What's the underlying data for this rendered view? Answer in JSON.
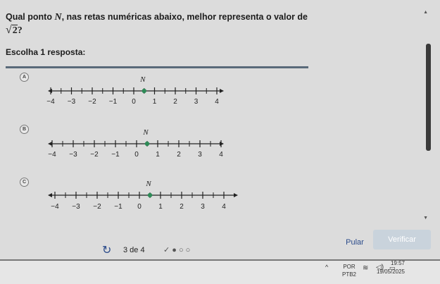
{
  "question": {
    "prefix": "Qual ponto ",
    "variable": "N",
    "suffix": ", nas retas numéricas abaixo, melhor representa o valor de",
    "radicand": "2",
    "end": "?"
  },
  "instruction": "Escolha 1 resposta:",
  "options": [
    {
      "letter": "A",
      "point_value": 0.5,
      "point_label": "N",
      "ticks": [
        "−4",
        "−3",
        "−2",
        "−1",
        "0",
        "1",
        "2",
        "3",
        "4"
      ]
    },
    {
      "letter": "B",
      "point_value": 0.5,
      "point_label": "N",
      "ticks": [
        "−4",
        "−3",
        "−2",
        "−1",
        "0",
        "1",
        "2",
        "3",
        "4"
      ]
    },
    {
      "letter": "C",
      "point_value": 0.5,
      "point_label": "N",
      "ticks": [
        "−4",
        "−3",
        "−2",
        "−1",
        "0",
        "1",
        "2",
        "3",
        "4"
      ]
    }
  ],
  "footer": {
    "counter": "3 de 4",
    "progress": "✓ ● ○ ○",
    "skip_label": "Pular",
    "check_label": "Verificar"
  },
  "taskbar": {
    "lang_top": "POR",
    "lang_bottom": "PTB2",
    "time": "19:57",
    "date": "19/05/2025"
  },
  "colors": {
    "point": "#2e8b57",
    "check_button": "#c9d3dc",
    "accent": "#2a4a8a"
  }
}
